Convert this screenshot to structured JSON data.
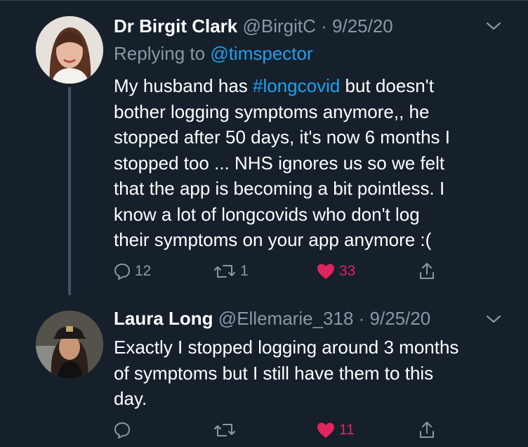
{
  "tweets": [
    {
      "name": "Dr Birgit Clark",
      "handle": "@BirgitC",
      "date": "9/25/20",
      "reply_prefix": "Replying to ",
      "reply_to": "@timspector",
      "text_lines": [
        "My husband has ",
        "#longcovid",
        " but doesn't",
        "bother logging symptoms anymore,, he",
        "stopped after 50 days, it's now 6 months I",
        "stopped too ... NHS ignores us so we felt",
        "that the app is becoming a bit pointless. I",
        "know a lot of longcovids who don't log",
        "their symptoms on your app anymore :("
      ],
      "replies": "12",
      "retweets": "1",
      "likes": "33"
    },
    {
      "name": "Laura Long",
      "handle": "@Ellemarie_318",
      "date": "9/25/20",
      "text_lines": [
        "Exactly I stopped logging around 3 months",
        "of symptoms but I still have them to this",
        "day."
      ],
      "likes": "11"
    }
  ],
  "separator": " · ",
  "icons": {
    "reply": "speech-bubble-icon",
    "retweet": "retweet-icon",
    "like": "heart-icon",
    "share": "share-icon",
    "menu": "chevron-down-icon"
  },
  "colors": {
    "background": "#15202b",
    "secondary_text": "#8899a6",
    "link": "#1da1f2",
    "like": "#e0245e"
  }
}
